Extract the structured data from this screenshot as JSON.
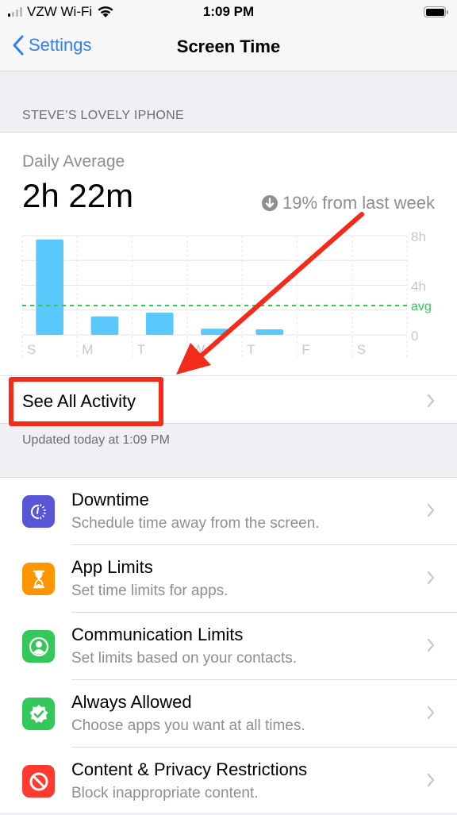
{
  "status_bar": {
    "carrier": "VZW Wi-Fi",
    "time": "1:09 PM",
    "signal_bars_on": 1,
    "signal_bars_total": 4,
    "battery_level": 1.0
  },
  "nav": {
    "back_label": "Settings",
    "title": "Screen Time"
  },
  "device_section": {
    "header": "STEVE’S LOVELY IPHONE"
  },
  "summary": {
    "daily_average_label": "Daily Average",
    "daily_average_value": "2h 22m",
    "delta_text": "19% from last week",
    "delta_direction": "down"
  },
  "chart_data": {
    "type": "bar",
    "categories": [
      "S",
      "M",
      "T",
      "W",
      "T",
      "F",
      "S"
    ],
    "values": [
      7.7,
      1.5,
      1.8,
      0.5,
      0.45,
      0,
      0
    ],
    "unit": "hours",
    "ylim": [
      0,
      8
    ],
    "yticks": [
      {
        "value": 8,
        "label": "8h"
      },
      {
        "value": 4,
        "label": "4h"
      },
      {
        "value": 0,
        "label": "0"
      }
    ],
    "average": {
      "value": 2.37,
      "label": "avg"
    },
    "grid": true,
    "colors": {
      "bar": "#5ac8fa",
      "avg": "#34c759",
      "grid": "#e5e5ea",
      "tick": "#c7c7cc"
    }
  },
  "see_all": {
    "label": "See All Activity"
  },
  "updated_text": "Updated today at 1:09 PM",
  "features": [
    {
      "title": "Downtime",
      "subtitle": "Schedule time away from the screen.",
      "icon": "downtime-icon",
      "color": "#5856d6"
    },
    {
      "title": "App Limits",
      "subtitle": "Set time limits for apps.",
      "icon": "hourglass-icon",
      "color": "#ff9500"
    },
    {
      "title": "Communication Limits",
      "subtitle": "Set limits based on your contacts.",
      "icon": "contact-icon",
      "color": "#34c759"
    },
    {
      "title": "Always Allowed",
      "subtitle": "Choose apps you want at all times.",
      "icon": "checkmark-badge-icon",
      "color": "#34c759"
    },
    {
      "title": "Content & Privacy Restrictions",
      "subtitle": "Block inappropriate content.",
      "icon": "restricted-icon",
      "color": "#ff3b30"
    }
  ],
  "annotation": {
    "color": "#f42b1a",
    "target": "See All Activity"
  }
}
